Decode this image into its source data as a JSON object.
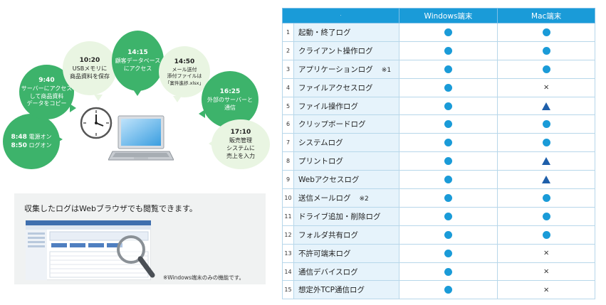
{
  "bubbles": [
    {
      "time": "8:48",
      "text1": "電源オン",
      "time2": "8:50",
      "text2": "ログオン"
    },
    {
      "time": "9:40",
      "lines": [
        "サーバーにアクセス",
        "して商品資料",
        "データをコピー"
      ]
    },
    {
      "time": "10:20",
      "lines": [
        "USBメモリに",
        "商品資料を保存"
      ]
    },
    {
      "time": "14:15",
      "lines": [
        "顧客データベース",
        "にアクセス"
      ]
    },
    {
      "time": "14:50",
      "lines": [
        "メール送付",
        "添付ファイルは",
        "「案件進捗.xlsx」"
      ]
    },
    {
      "time": "16:25",
      "lines": [
        "外部のサーバーと",
        "通信"
      ]
    },
    {
      "time": "17:10",
      "lines": [
        "販売管理",
        "システムに",
        "売上を入力"
      ]
    }
  ],
  "panel": {
    "title": "収集したログはWebブラウザでも閲覧できます。",
    "note": "※Windows端末のみの機能です。"
  },
  "table": {
    "header_blank": "·",
    "col_windows": "Windows端末",
    "col_mac": "Mac端末",
    "rows": [
      {
        "no": "1",
        "name": "起動・終了ログ",
        "note": "",
        "win": "circle",
        "mac": "circle"
      },
      {
        "no": "2",
        "name": "クライアント操作ログ",
        "note": "",
        "win": "circle",
        "mac": "circle"
      },
      {
        "no": "3",
        "name": "アプリケーションログ",
        "note": "※1",
        "win": "circle",
        "mac": "circle"
      },
      {
        "no": "4",
        "name": "ファイルアクセスログ",
        "note": "",
        "win": "circle",
        "mac": "cross"
      },
      {
        "no": "5",
        "name": "ファイル操作ログ",
        "note": "",
        "win": "circle",
        "mac": "triangle"
      },
      {
        "no": "6",
        "name": "クリップボードログ",
        "note": "",
        "win": "circle",
        "mac": "circle"
      },
      {
        "no": "7",
        "name": "システムログ",
        "note": "",
        "win": "circle",
        "mac": "circle"
      },
      {
        "no": "8",
        "name": "プリントログ",
        "note": "",
        "win": "circle",
        "mac": "triangle"
      },
      {
        "no": "9",
        "name": "Webアクセスログ",
        "note": "",
        "win": "circle",
        "mac": "triangle"
      },
      {
        "no": "10",
        "name": "送信メールログ",
        "note": "※2",
        "win": "circle",
        "mac": "circle"
      },
      {
        "no": "11",
        "name": "ドライブ追加・削除ログ",
        "note": "",
        "win": "circle",
        "mac": "circle"
      },
      {
        "no": "12",
        "name": "フォルダ共有ログ",
        "note": "",
        "win": "circle",
        "mac": "circle"
      },
      {
        "no": "13",
        "name": "不許可端末ログ",
        "note": "",
        "win": "circle",
        "mac": "cross"
      },
      {
        "no": "14",
        "name": "通信デバイスログ",
        "note": "",
        "win": "circle",
        "mac": "cross"
      },
      {
        "no": "15",
        "name": "想定外TCP通信ログ",
        "note": "",
        "win": "circle",
        "mac": "cross"
      }
    ],
    "cross_symbol": "×"
  },
  "colors": {
    "bubble_green": "#3db36b",
    "bubble_light": "#e9f5e2",
    "header_blue": "#1a9bd8",
    "name_cell_bg": "#e6f3fb",
    "triangle_blue": "#1e5faa"
  }
}
